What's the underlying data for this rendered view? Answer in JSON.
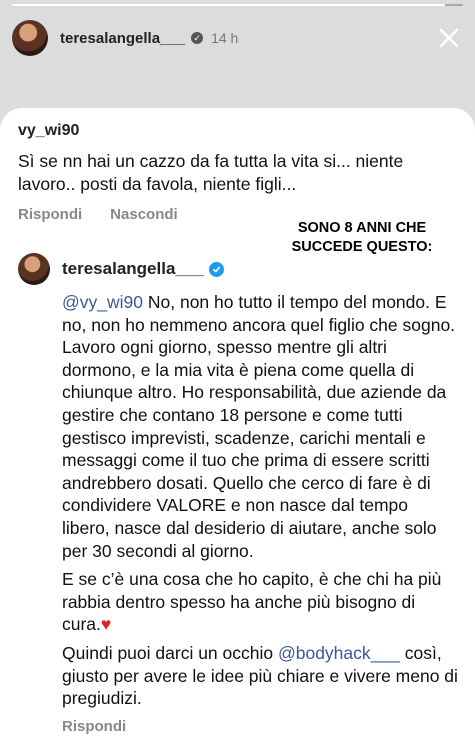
{
  "story": {
    "progress": 0.96,
    "username": "teresalangella___",
    "verified_icon": "verified-badge-icon",
    "time": "14 h",
    "close_icon": "close-icon"
  },
  "comment": {
    "username": "vy_wi90",
    "text": "Sì se nn hai un  cazzo da fa tutta la vita si... niente lavoro.. posti da favola, niente figli...",
    "reply_label": "Rispondi",
    "hide_label": "Nascondi"
  },
  "overlay": {
    "line1": "SONO 8 ANNI CHE",
    "line2": "SUCCEDE QUESTO:"
  },
  "reply": {
    "username": "teresalangella___",
    "mention": "@vy_wi90",
    "paragraph1": " No, non ho tutto il tempo del mondo. E no, non ho nemmeno ancora quel figlio che sogno. Lavoro ogni giorno, spesso mentre gli altri dormono, e la mia vita è piena come quella di chiunque altro. Ho responsabilità, due aziende da gestire che contano 18 persone e come tutti gestisco imprevisti, scadenze, carichi mentali e messaggi come il tuo che prima di essere scritti andrebbero dosati. Quello che cerco di fare è di condividere VALORE e non nasce dal tempo libero, nasce dal desiderio di aiutare, anche solo per 30 secondi al giorno.",
    "paragraph2": "E se c’è una cosa che ho capito, è che chi ha più rabbia dentro spesso ha anche più bisogno di cura.",
    "heart": "♥",
    "paragraph3_start": "Quindi puoi darci un occhio ",
    "paragraph3_mention": "@bodyhack___",
    "paragraph3_end": " così, giusto per avere le idee più chiare e vivere meno di pregiudizi.",
    "reply_label": "Rispondi"
  },
  "colors": {
    "background": "#dcdcdc",
    "card": "#ffffff",
    "mention": "#3b5998",
    "verified": "#1d9bf0",
    "heart": "#e0202a"
  }
}
